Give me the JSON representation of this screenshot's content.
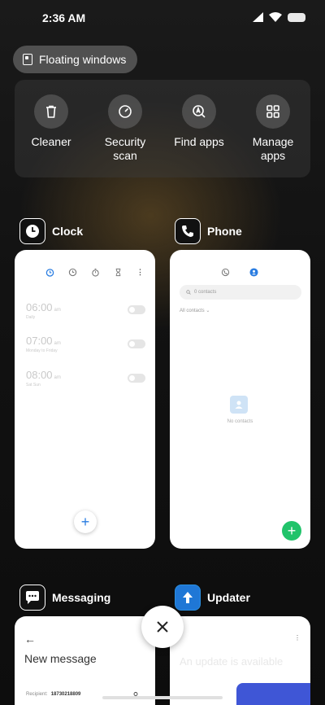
{
  "status": {
    "time": "2:36 AM"
  },
  "floating": {
    "label": "Floating windows"
  },
  "quick_actions": [
    {
      "label": "Cleaner",
      "icon": "trash-icon"
    },
    {
      "label": "Security scan",
      "icon": "speedometer-icon"
    },
    {
      "label": "Find apps",
      "icon": "search-app-icon"
    },
    {
      "label": "Manage apps",
      "icon": "grid-icon"
    }
  ],
  "apps": {
    "clock": {
      "name": "Clock",
      "alarms": [
        {
          "time": "06:00",
          "ampm": "am",
          "sub": "Daily"
        },
        {
          "time": "07:00",
          "ampm": "am",
          "sub": "Monday to Friday"
        },
        {
          "time": "08:00",
          "ampm": "am",
          "sub": "Sat Sun"
        }
      ]
    },
    "phone": {
      "name": "Phone",
      "search_placeholder": "0 contacts",
      "all_contacts": "All contacts",
      "empty_text": "No contacts"
    },
    "messaging": {
      "name": "Messaging",
      "title": "New message",
      "recipient_label": "Recipient:",
      "recipient_value": "18730218809"
    },
    "updater": {
      "name": "Updater",
      "text": "An update is available"
    }
  },
  "colors": {
    "accent_blue": "#2a7de1",
    "fab_green": "#21c36a",
    "updater_blue": "#3f56d6"
  }
}
